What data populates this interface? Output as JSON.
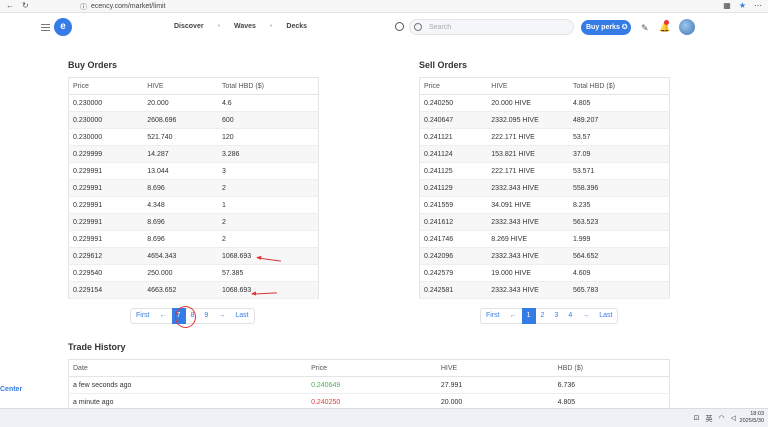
{
  "browser": {
    "url": "ecency.com/market/limit"
  },
  "header": {
    "nav": [
      "Discover",
      "Waves",
      "Decks"
    ],
    "search_placeholder": "Search",
    "perks_label": "Buy perks"
  },
  "buy": {
    "title": "Buy Orders",
    "columns": [
      "Price",
      "HIVE",
      "Total HBD ($)"
    ],
    "rows": [
      [
        "0.230000",
        "20.000",
        "4.6"
      ],
      [
        "0.230000",
        "2608.696",
        "600"
      ],
      [
        "0.230000",
        "521.740",
        "120"
      ],
      [
        "0.229999",
        "14.287",
        "3.286"
      ],
      [
        "0.229991",
        "13.044",
        "3"
      ],
      [
        "0.229991",
        "8.696",
        "2"
      ],
      [
        "0.229991",
        "4.348",
        "1"
      ],
      [
        "0.229991",
        "8.696",
        "2"
      ],
      [
        "0.229991",
        "8.696",
        "2"
      ],
      [
        "0.229612",
        "4654.343",
        "1068.693"
      ],
      [
        "0.229540",
        "250.000",
        "57.385"
      ],
      [
        "0.229154",
        "4663.652",
        "1068.693"
      ]
    ],
    "pager": {
      "first": "First",
      "prev": "←",
      "pages": [
        "7",
        "8",
        "9"
      ],
      "next": "→",
      "last": "Last"
    }
  },
  "sell": {
    "title": "Sell Orders",
    "columns": [
      "Price",
      "HIVE",
      "Total HBD ($)"
    ],
    "rows": [
      [
        "0.240250",
        "20.000 HIVE",
        "4.805"
      ],
      [
        "0.240647",
        "2332.095 HIVE",
        "489.207"
      ],
      [
        "0.241121",
        "222.171 HIVE",
        "53.57"
      ],
      [
        "0.241124",
        "153.821 HIVE",
        "37.09"
      ],
      [
        "0.241125",
        "222.171 HIVE",
        "53.571"
      ],
      [
        "0.241129",
        "2332.343 HIVE",
        "558.396"
      ],
      [
        "0.241559",
        "34.091 HIVE",
        "8.235"
      ],
      [
        "0.241612",
        "2332.343 HIVE",
        "563.523"
      ],
      [
        "0.241746",
        "8.269 HIVE",
        "1.999"
      ],
      [
        "0.242096",
        "2332.343 HIVE",
        "564.652"
      ],
      [
        "0.242579",
        "19.000 HIVE",
        "4.609"
      ],
      [
        "0.242581",
        "2332.343 HIVE",
        "565.783"
      ]
    ],
    "pager": {
      "first": "First",
      "prev": "←",
      "pages": [
        "1",
        "2",
        "3",
        "4"
      ],
      "next": "→",
      "last": "Last"
    }
  },
  "trades": {
    "title": "Trade History",
    "columns": [
      "Date",
      "Price",
      "HIVE",
      "HBD ($)"
    ],
    "rows": [
      [
        "a few seconds ago",
        "0.240649",
        "27.991",
        "6.736"
      ],
      [
        "a minute ago",
        "0.240250",
        "20.000",
        "4.805"
      ]
    ],
    "price_colors": [
      "#4caf50",
      "#e53935"
    ]
  },
  "sidebar_label": "Center",
  "taskbar": {
    "lang": "英",
    "time": "18:03",
    "date": "2025/5/30"
  }
}
